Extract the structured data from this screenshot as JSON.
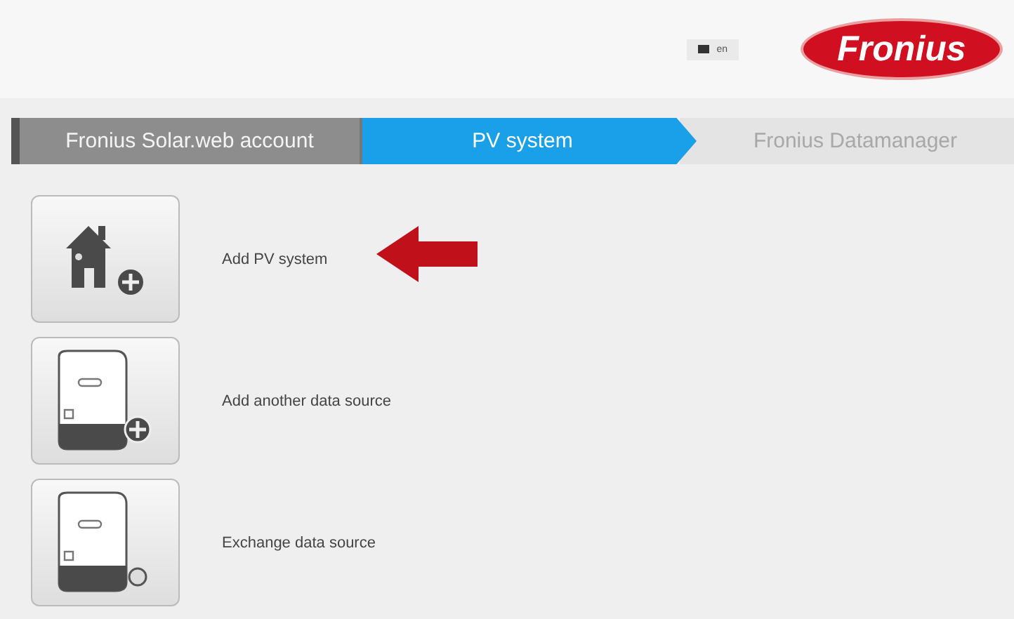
{
  "header": {
    "language": "en",
    "logo": "Fronius"
  },
  "steps": [
    {
      "label": "Fronius Solar.web account",
      "kind": "done"
    },
    {
      "label": "PV system",
      "kind": "current"
    },
    {
      "label": "Fronius Datamanager",
      "kind": "upcoming"
    }
  ],
  "actions": [
    {
      "label": "Add PV system",
      "kind": "house-add",
      "pointed": true
    },
    {
      "label": "Add another data source",
      "kind": "device-add",
      "pointed": false
    },
    {
      "label": "Exchange data source",
      "kind": "device-exchange",
      "pointed": false
    }
  ]
}
